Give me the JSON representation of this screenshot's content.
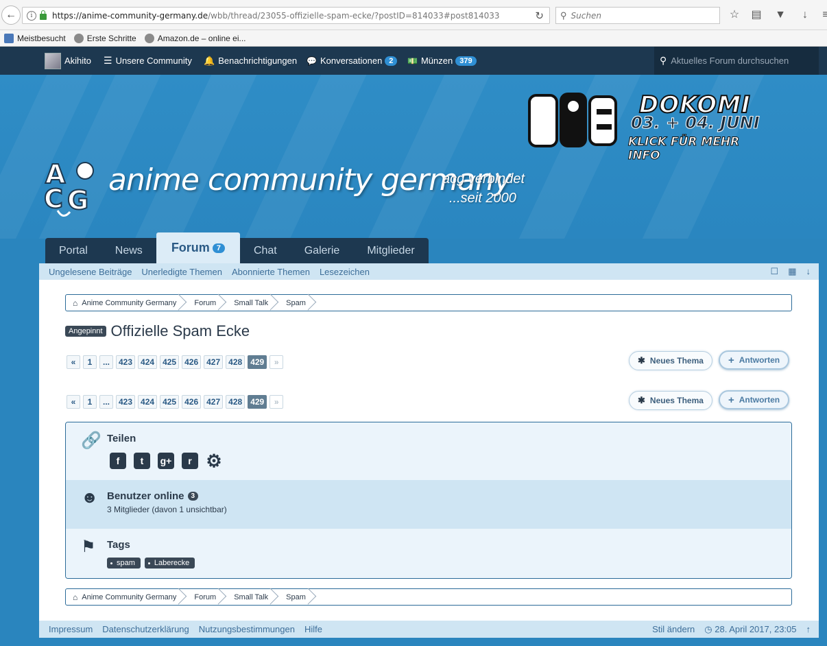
{
  "browser": {
    "url_host": "https://anime-community-germany.de",
    "url_path": "/wbb/thread/23055-offizielle-spam-ecke/?postID=814033#post814033",
    "search_placeholder": "Suchen",
    "bookmarks": [
      {
        "label": "Meistbesucht"
      },
      {
        "label": "Erste Schritte"
      },
      {
        "label": "Amazon.de – online ei..."
      }
    ]
  },
  "userbar": {
    "username": "Akihito",
    "community_label": "Unsere Community",
    "notifications_label": "Benachrichtigungen",
    "conversations_label": "Konversationen",
    "conversations_count": "2",
    "coins_label": "Münzen",
    "coins_count": "379",
    "search_placeholder": "Aktuelles Forum durchsuchen"
  },
  "header": {
    "logo_text": "anime community germany",
    "tagline_1": "acg verbindet",
    "tagline_2": "...seit 2000",
    "banner_title": "DOKOMI",
    "banner_date": "03. + 04. JUNI",
    "banner_info": "KLICK FÜR MEHR INFO"
  },
  "tabs": [
    {
      "label": "Portal"
    },
    {
      "label": "News"
    },
    {
      "label": "Forum",
      "badge": "7"
    },
    {
      "label": "Chat"
    },
    {
      "label": "Galerie"
    },
    {
      "label": "Mitglieder"
    }
  ],
  "subnav": [
    "Ungelesene Beiträge",
    "Unerledigte Themen",
    "Abonnierte Themen",
    "Lesezeichen"
  ],
  "breadcrumb": [
    "Anime Community Germany",
    "Forum",
    "Small Talk",
    "Spam"
  ],
  "thread": {
    "pin_label": "Angepinnt",
    "title": "Offizielle Spam Ecke"
  },
  "pagination": {
    "first": "«",
    "pages": [
      "1",
      "...",
      "423",
      "424",
      "425",
      "426",
      "427",
      "428",
      "429"
    ],
    "current": "429",
    "next": "»"
  },
  "actions": {
    "new_thread": "Neues Thema",
    "reply": "Antworten"
  },
  "share": {
    "title": "Teilen"
  },
  "online": {
    "title": "Benutzer online",
    "count": "3",
    "detail": "3 Mitglieder (davon 1 unsichtbar)"
  },
  "tags": {
    "title": "Tags",
    "items": [
      "spam",
      "Laberecke"
    ]
  },
  "footer": {
    "links": [
      "Impressum",
      "Datenschutzerklärung",
      "Nutzungsbestimmungen",
      "Hilfe"
    ],
    "style_label": "Stil ändern",
    "timestamp": "28. April 2017, 23:05"
  }
}
